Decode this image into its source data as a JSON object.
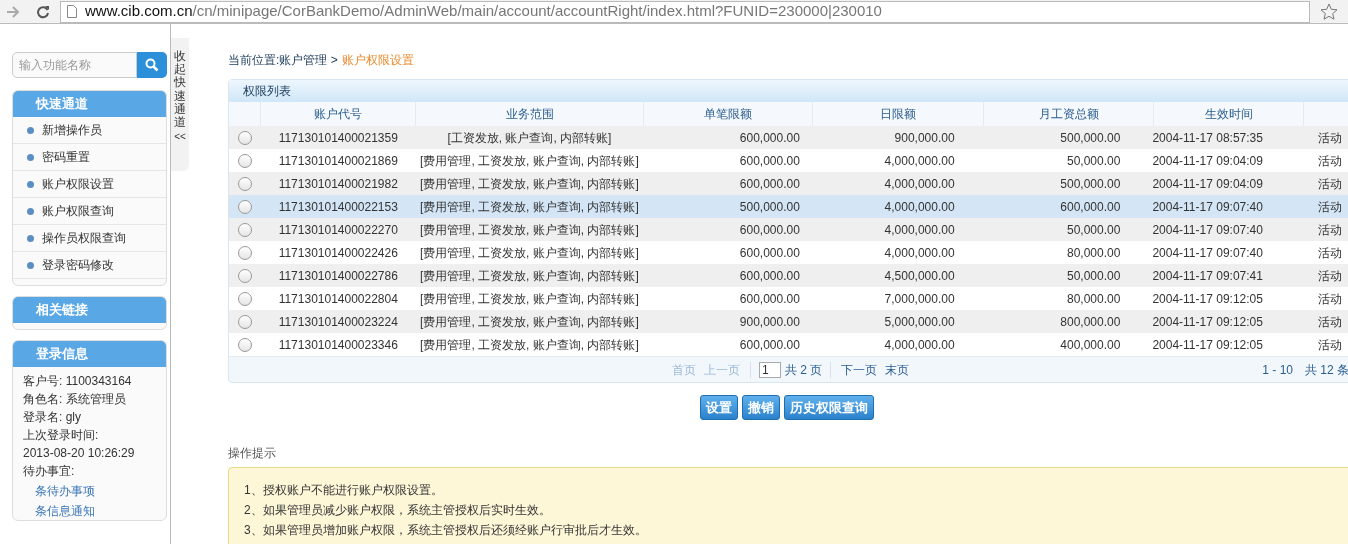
{
  "browser": {
    "url": "**www.cib.com.cn**/cn/minipage/CorBankDemo/AdminWeb/main/account/accountRight/index.html?FUNID=230000|230010"
  },
  "sidebar": {
    "search": {
      "placeholder": "输入功能名称"
    },
    "quick": {
      "title": "快速通道",
      "items": [
        "新增操作员",
        "密码重置",
        "账户权限设置",
        "账户权限查询",
        "操作员权限查询",
        "登录密码修改"
      ]
    },
    "links": {
      "title": "相关链接"
    },
    "login": {
      "title": "登录信息",
      "lines": [
        "客户号: 1100343164",
        "角色名: 系统管理员",
        "登录名: gly",
        "上次登录时间:",
        "2013-08-20 10:26:29",
        "待办事宜:"
      ],
      "todo": [
        "条待办事项",
        "条信息通知"
      ]
    }
  },
  "collapse_tab": {
    "label": "收起快速通道",
    "arrow": "<<"
  },
  "breadcrumb": {
    "path": "当前位置:账户管理 >",
    "current": "账户权限设置"
  },
  "table": {
    "title": "权限列表",
    "columns": [
      "账户代号",
      "业务范围",
      "单笔限额",
      "日限额",
      "月工资总额",
      "生效时间"
    ],
    "rows": [
      {
        "selected": false,
        "checked": false,
        "cells": [
          "117130101400021359",
          "[工资发放, 账户查询, 内部转账]",
          "600,000.00",
          "900,000.00",
          "500,000.00",
          "2004-11-17 08:57:35",
          "活动"
        ]
      },
      {
        "selected": false,
        "checked": false,
        "cells": [
          "117130101400021869",
          "[费用管理, 工资发放, 账户查询, 内部转账]",
          "600,000.00",
          "4,000,000.00",
          "50,000.00",
          "2004-11-17 09:04:09",
          "活动"
        ]
      },
      {
        "selected": false,
        "checked": false,
        "cells": [
          "117130101400021982",
          "[费用管理, 工资发放, 账户查询, 内部转账]",
          "600,000.00",
          "4,000,000.00",
          "500,000.00",
          "2004-11-17 09:04:09",
          "活动"
        ]
      },
      {
        "selected": true,
        "checked": false,
        "cells": [
          "117130101400022153",
          "[费用管理, 工资发放, 账户查询, 内部转账]",
          "500,000.00",
          "4,000,000.00",
          "600,000.00",
          "2004-11-17 09:07:40",
          "活动"
        ]
      },
      {
        "selected": false,
        "checked": false,
        "cells": [
          "117130101400022270",
          "[费用管理, 工资发放, 账户查询, 内部转账]",
          "600,000.00",
          "4,000,000.00",
          "50,000.00",
          "2004-11-17 09:07:40",
          "活动"
        ]
      },
      {
        "selected": false,
        "checked": false,
        "cells": [
          "117130101400022426",
          "[费用管理, 工资发放, 账户查询, 内部转账]",
          "600,000.00",
          "4,000,000.00",
          "80,000.00",
          "2004-11-17 09:07:40",
          "活动"
        ]
      },
      {
        "selected": false,
        "checked": false,
        "cells": [
          "117130101400022786",
          "[费用管理, 工资发放, 账户查询, 内部转账]",
          "600,000.00",
          "4,500,000.00",
          "50,000.00",
          "2004-11-17 09:07:41",
          "活动"
        ]
      },
      {
        "selected": false,
        "checked": false,
        "cells": [
          "117130101400022804",
          "[费用管理, 工资发放, 账户查询, 内部转账]",
          "600,000.00",
          "7,000,000.00",
          "80,000.00",
          "2004-11-17 09:12:05",
          "活动"
        ]
      },
      {
        "selected": false,
        "checked": false,
        "cells": [
          "117130101400023224",
          "[费用管理, 工资发放, 账户查询, 内部转账]",
          "900,000.00",
          "5,000,000.00",
          "800,000.00",
          "2004-11-17 09:12:05",
          "活动"
        ]
      },
      {
        "selected": false,
        "checked": false,
        "cells": [
          "117130101400023346",
          "[费用管理, 工资发放, 账户查询, 内部转账]",
          "600,000.00",
          "4,000,000.00",
          "400,000.00",
          "2004-11-17 09:12:05",
          "活动"
        ]
      }
    ],
    "pager": {
      "first": {
        "label": "首页",
        "disabled": true
      },
      "prev": {
        "label": "上一页",
        "disabled": true
      },
      "page": "1",
      "total_pages": "共 2 页",
      "next": {
        "label": "下一页",
        "disabled": false
      },
      "last": {
        "label": "末页",
        "disabled": false
      },
      "range": "1 - 10",
      "total": "共 12 条"
    }
  },
  "buttons": [
    "设置",
    "撤销",
    "历史权限查询"
  ],
  "tips": {
    "title": "操作提示",
    "lines": [
      "1、授权账户不能进行账户权限设置。",
      "2、如果管理员减少账户权限，系统主管授权后实时生效。",
      "3、如果管理员增加账户权限，系统主管授权后还须经账户行审批后才生效。"
    ]
  }
}
